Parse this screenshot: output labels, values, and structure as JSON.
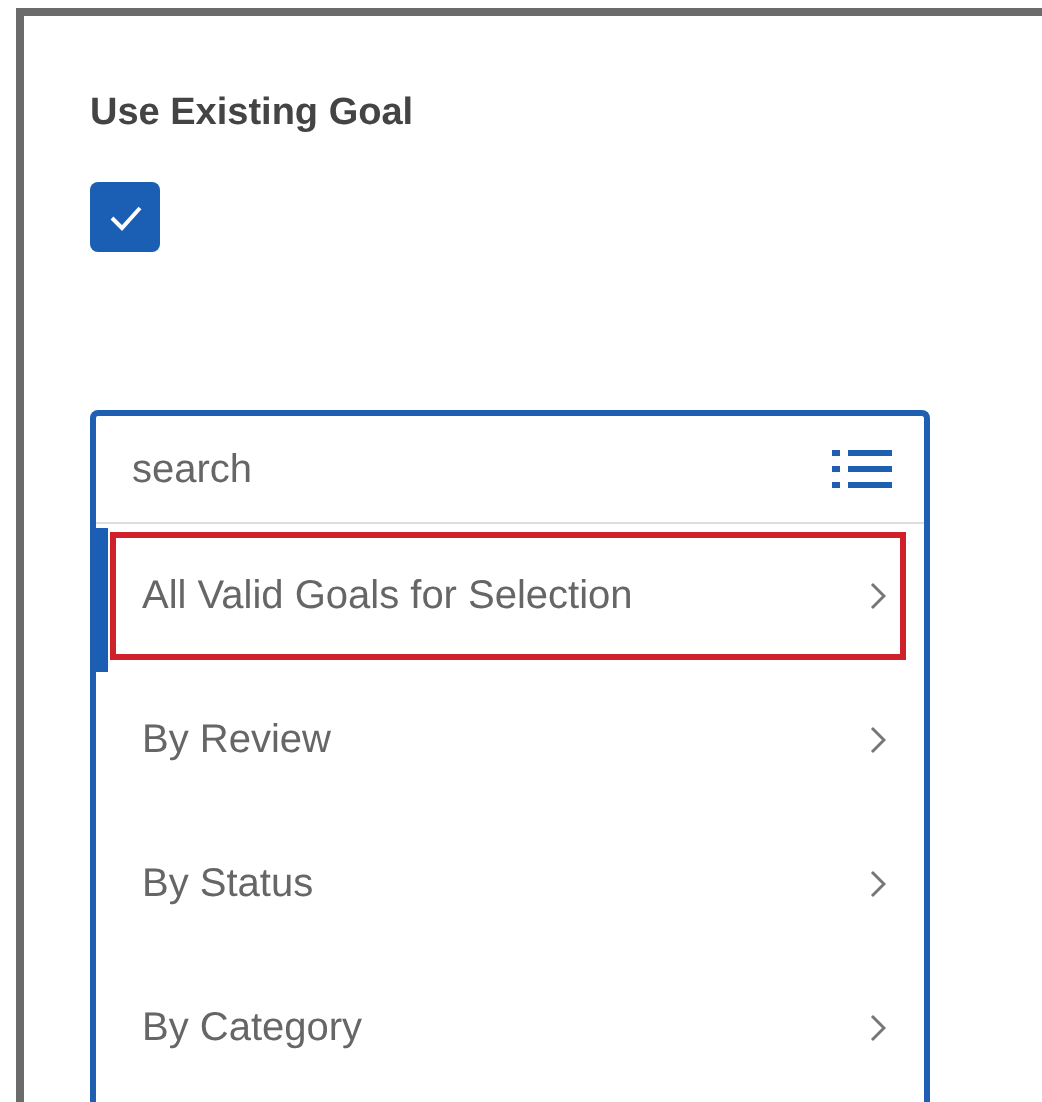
{
  "field": {
    "label": "Use Existing Goal",
    "checked": true
  },
  "prompt": {
    "placeholder": "search",
    "items": [
      {
        "label": "All Valid Goals for Selection",
        "selected": true,
        "highlighted": true
      },
      {
        "label": "By Review",
        "selected": false,
        "highlighted": false
      },
      {
        "label": "By Status",
        "selected": false,
        "highlighted": false
      },
      {
        "label": "By Category",
        "selected": false,
        "highlighted": false
      }
    ]
  }
}
